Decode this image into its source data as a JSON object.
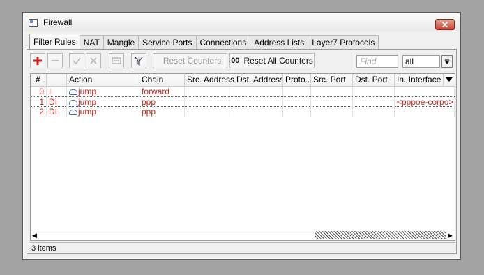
{
  "window": {
    "title": "Firewall",
    "close_label": "✕"
  },
  "tabs": [
    {
      "label": "Filter Rules",
      "active": true
    },
    {
      "label": "NAT"
    },
    {
      "label": "Mangle"
    },
    {
      "label": "Service Ports"
    },
    {
      "label": "Connections"
    },
    {
      "label": "Address Lists"
    },
    {
      "label": "Layer7 Protocols"
    }
  ],
  "toolbar": {
    "reset_counters": "Reset Counters",
    "reset_all_counters": "Reset All Counters",
    "reset_all_prefix": "00",
    "find_placeholder": "Find",
    "filter_value": "all"
  },
  "table": {
    "columns": [
      "#",
      "Action",
      "Chain",
      "Src. Address",
      "Dst. Address",
      "Proto...",
      "Src. Port",
      "Dst. Port",
      "In. Interface"
    ],
    "rows": [
      {
        "num": "0",
        "flags": "I",
        "action": "jump",
        "chain": "forward",
        "in_interface": ""
      },
      {
        "num": "1",
        "flags": "DI",
        "action": "jump",
        "chain": "ppp",
        "in_interface": "<pppoe-corpo>"
      },
      {
        "num": "2",
        "flags": "DI",
        "action": "jump",
        "chain": "ppp",
        "in_interface": ""
      }
    ]
  },
  "status": {
    "items": "3 items"
  },
  "colors": {
    "row_text": "#c4261a",
    "accent_add": "#d01f1f",
    "action_icon": "#3f6fb7"
  }
}
